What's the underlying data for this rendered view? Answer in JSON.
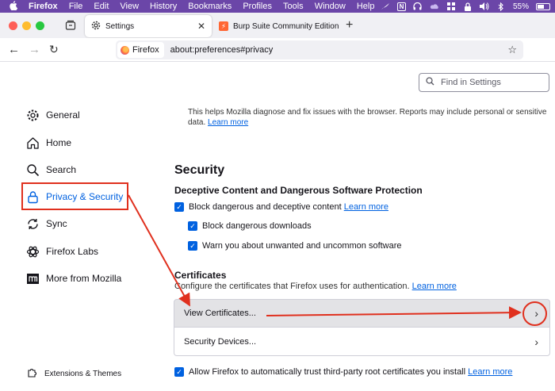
{
  "menubar": {
    "app": "Firefox",
    "items": [
      "File",
      "Edit",
      "View",
      "History",
      "Bookmarks",
      "Profiles",
      "Tools",
      "Window",
      "Help"
    ],
    "battery": "55%"
  },
  "tabs": [
    {
      "label": "Settings",
      "active": true
    },
    {
      "label": "Burp Suite Community Edition",
      "active": false
    }
  ],
  "navbar": {
    "identity": "Firefox",
    "url": "about:preferences#privacy"
  },
  "search": {
    "placeholder": "Find in Settings"
  },
  "sidebar": {
    "items": [
      {
        "label": "General",
        "icon": "gear-icon"
      },
      {
        "label": "Home",
        "icon": "home-icon"
      },
      {
        "label": "Search",
        "icon": "search-icon"
      },
      {
        "label": "Privacy & Security",
        "icon": "lock-icon",
        "selected": true
      },
      {
        "label": "Sync",
        "icon": "sync-icon"
      },
      {
        "label": "Firefox Labs",
        "icon": "labs-icon"
      },
      {
        "label": "More from Mozilla",
        "icon": "mozilla-icon"
      }
    ],
    "extensions": "Extensions & Themes"
  },
  "telemetry": {
    "text": "This helps Mozilla diagnose and fix issues with the browser. Reports may include personal or sensitive data.",
    "learn_more": "Learn more"
  },
  "security": {
    "title": "Security",
    "subtitle": "Deceptive Content and Dangerous Software Protection",
    "block_dangerous": "Block dangerous and deceptive content",
    "learn_more": "Learn more",
    "block_downloads": "Block dangerous downloads",
    "warn_unwanted": "Warn you about unwanted and uncommon software"
  },
  "certificates": {
    "title": "Certificates",
    "description": "Configure the certificates that Firefox uses for authentication.",
    "learn_more": "Learn more",
    "view_button": "View Certificates...",
    "devices_button": "Security Devices...",
    "allow_thirdparty": "Allow Firefox to automatically trust third-party root certificates you install",
    "allow_learn_more": "Learn more"
  },
  "colors": {
    "menubar": "#6b46a8",
    "accent": "#0061e0",
    "annotation": "#e0301e"
  }
}
